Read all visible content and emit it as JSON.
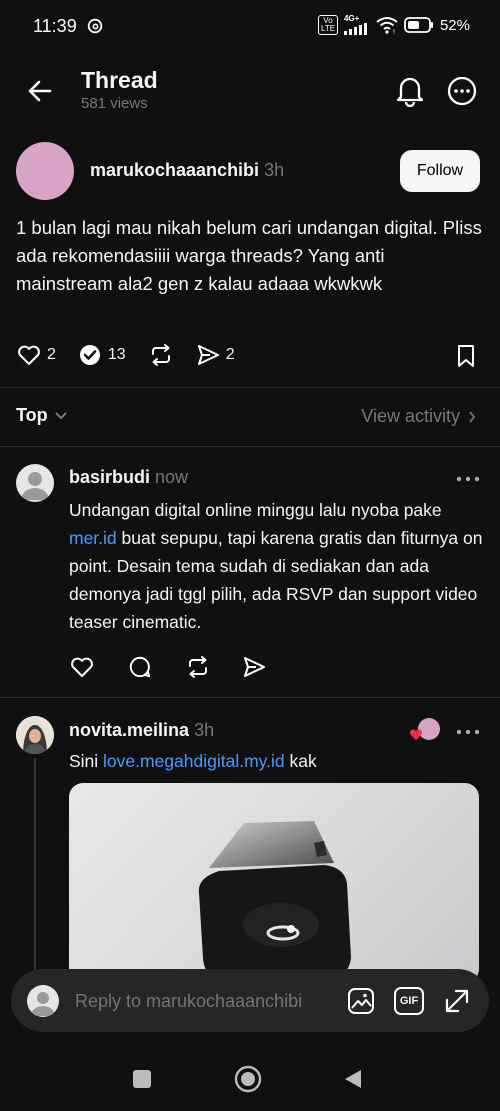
{
  "status": {
    "time": "11:39",
    "battery": "52%",
    "network_top": "4G+",
    "volte": "Vo LTE"
  },
  "header": {
    "title": "Thread",
    "views": "581 views"
  },
  "post": {
    "username": "marukochaaanchibi",
    "time": "3h",
    "follow_label": "Follow",
    "text": "1 bulan lagi mau nikah belum cari undangan digital. Pliss ada rekomendasiiii warga threads? Yang anti mainstream ala2 gen z kalau adaaa wkwkwk",
    "likes": "2",
    "comments": "13",
    "shares": "2",
    "avatar_color": "#d7a3c7"
  },
  "sort": {
    "label": "Top",
    "view_activity": "View activity"
  },
  "replies": [
    {
      "username": "basirbudi",
      "time": "now",
      "text_pre": "Undangan digital online minggu lalu nyoba pake ",
      "link": "mer.id",
      "text_post": " buat sepupu, tapi karena gratis dan fiturnya on point. Desain tema sudah di sediakan dan ada demonya jadi tggl pilih, ada RSVP dan support video teaser cinematic."
    },
    {
      "username": "novita.meilina",
      "time": "3h",
      "text_pre": "Sini ",
      "link": "love.megahdigital.my.id",
      "text_post": " kak"
    }
  ],
  "composer": {
    "placeholder": "Reply to marukochaaanchibi",
    "gif_label": "GIF"
  },
  "colors": {
    "background": "#101010",
    "link": "#4a9bff",
    "muted": "#777777"
  }
}
